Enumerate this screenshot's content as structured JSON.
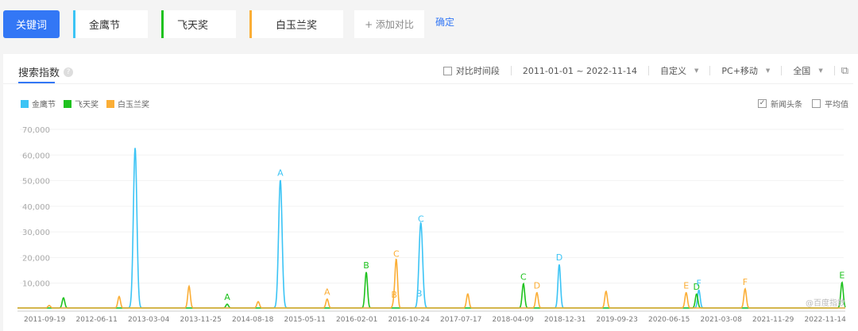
{
  "toolbar": {
    "keyword_label": "关键词",
    "terms": [
      "金鹰节",
      "飞天奖",
      "白玉兰奖"
    ],
    "add_label": "+ 添加对比",
    "confirm_label": "确定"
  },
  "panel": {
    "title": "搜索指数",
    "help": "?",
    "compare_period": "对比时间段",
    "date_range": "2011-01-01 ~ 2022-11-14",
    "custom": "自定义",
    "device": "PC+移动",
    "region": "全国",
    "news_label": "新闻头条",
    "avg_label": "平均值",
    "watermark": "@百度指数"
  },
  "colors": {
    "金鹰节": "#3cc4f5",
    "飞天奖": "#1fc21f",
    "白玉兰奖": "#fbae36"
  },
  "chart_data": {
    "type": "line",
    "title": "搜索指数",
    "start": "2011-01-01",
    "end": "2022-11-14",
    "ylim": [
      0,
      70000
    ],
    "yticks": [
      "70,000",
      "60,000",
      "50,000",
      "40,000",
      "30,000",
      "20,000",
      "10,000"
    ],
    "ytick_values": [
      70000,
      60000,
      50000,
      40000,
      30000,
      20000,
      10000
    ],
    "xticks": [
      "2011-09-19",
      "2012-06-11",
      "2013-03-04",
      "2013-11-25",
      "2014-08-18",
      "2015-05-11",
      "2016-02-01",
      "2016-10-24",
      "2017-07-17",
      "2018-04-09",
      "2018-12-31",
      "2019-09-23",
      "2020-06-15",
      "2021-03-08",
      "2021-11-29",
      "2022-11-14"
    ],
    "baseline": 300,
    "series": [
      {
        "name": "金鹰节",
        "color": "#3cc4f5",
        "peaks": [
          [
            "2012-10-14",
            62500
          ],
          [
            "2014-11-07",
            50000
          ],
          [
            "2016-10-28",
            3000
          ],
          [
            "2016-11-06",
            32000
          ],
          [
            "2018-10-25",
            17000
          ],
          [
            "2020-10-19",
            7000
          ]
        ]
      },
      {
        "name": "飞天奖",
        "color": "#1fc21f",
        "peaks": [
          [
            "2011-10-08",
            4000
          ],
          [
            "2014-02-04",
            1500
          ],
          [
            "2016-01-27",
            14000
          ],
          [
            "2018-04-22",
            9500
          ],
          [
            "2020-10-07",
            5500
          ],
          [
            "2022-11-01",
            10000
          ]
        ]
      },
      {
        "name": "白玉兰奖",
        "color": "#fbae36",
        "peaks": [
          [
            "2011-07-26",
            1000
          ],
          [
            "2012-07-23",
            4500
          ],
          [
            "2013-07-21",
            8500
          ],
          [
            "2014-07-15",
            2500
          ],
          [
            "2015-07-08",
            3500
          ],
          [
            "2016-06-20",
            2500
          ],
          [
            "2016-07-01",
            18500
          ],
          [
            "2017-07-07",
            5500
          ],
          [
            "2018-07-01",
            6000
          ],
          [
            "2019-06-25",
            6500
          ],
          [
            "2020-08-14",
            6000
          ],
          [
            "2021-06-16",
            7500
          ]
        ]
      }
    ],
    "annotations": [
      {
        "label": "A",
        "series": "金鹰节",
        "date": "2014-11-07",
        "value": 50000
      },
      {
        "label": "A",
        "series": "飞天奖",
        "date": "2014-02-04",
        "value": 1500
      },
      {
        "label": "A",
        "series": "白玉兰奖",
        "date": "2015-07-08",
        "value": 3500
      },
      {
        "label": "B",
        "series": "飞天奖",
        "date": "2016-01-27",
        "value": 14000
      },
      {
        "label": "B",
        "series": "白玉兰奖",
        "date": "2016-06-20",
        "value": 2500
      },
      {
        "label": "B",
        "series": "金鹰节",
        "date": "2016-10-28",
        "value": 3000
      },
      {
        "label": "C",
        "series": "白玉兰奖",
        "date": "2016-07-01",
        "value": 18500
      },
      {
        "label": "C",
        "series": "金鹰节",
        "date": "2016-11-06",
        "value": 32000
      },
      {
        "label": "C",
        "series": "飞天奖",
        "date": "2018-04-22",
        "value": 9500
      },
      {
        "label": "D",
        "series": "白玉兰奖",
        "date": "2018-07-01",
        "value": 6000
      },
      {
        "label": "D",
        "series": "金鹰节",
        "date": "2018-10-25",
        "value": 17000
      },
      {
        "label": "D",
        "series": "飞天奖",
        "date": "2020-10-07",
        "value": 5500
      },
      {
        "label": "E",
        "series": "白玉兰奖",
        "date": "2020-08-14",
        "value": 6000
      },
      {
        "label": "E",
        "series": "飞天奖",
        "date": "2022-11-01",
        "value": 10000
      },
      {
        "label": "F",
        "series": "金鹰节",
        "date": "2020-10-19",
        "value": 7000
      },
      {
        "label": "F",
        "series": "白玉兰奖",
        "date": "2021-06-16",
        "value": 7500
      }
    ]
  }
}
